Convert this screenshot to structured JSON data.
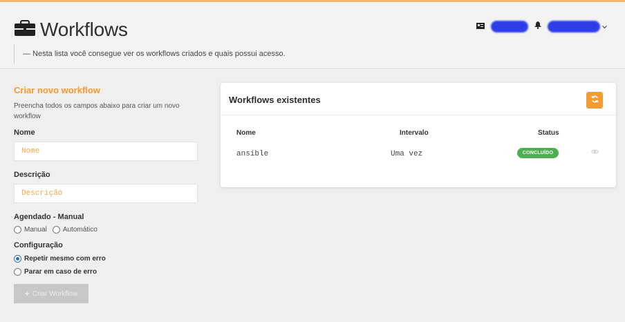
{
  "header": {
    "title": "Workflows",
    "subtitle": "— Nesta lista você consegue ver os workflows criados e quais possui acesso."
  },
  "form": {
    "title": "Criar novo workflow",
    "description": "Preencha todos os campos abaixo para criar um novo workflow",
    "name_label": "Nome",
    "name_placeholder": "Nome",
    "description_label": "Descrição",
    "description_placeholder": "Descrição",
    "schedule_label": "Agendado - Manual",
    "schedule_options": [
      "Manual",
      "Automático"
    ],
    "config_label": "Configuração",
    "config_options": [
      "Repetir mesmo com erro",
      "Parar em caso de erro"
    ],
    "config_selected": "Repetir mesmo com erro",
    "create_button_label": "Criar Workflow"
  },
  "table": {
    "title": "Workflows existentes",
    "columns": [
      "Nome",
      "Intervalo",
      "Status"
    ],
    "rows": [
      {
        "name": "ansible",
        "interval": "Uma vez",
        "status": "CONCLUÍDO"
      }
    ]
  },
  "icons": {
    "brand": "briefcase-icon",
    "notifications": "bell-icon",
    "refresh": "refresh-icon",
    "view": "eye-icon",
    "add": "plus-icon",
    "user_dropdown": "chevron-down-icon"
  },
  "colors": {
    "accent": "#f29b33",
    "success": "#4caf50",
    "radio_selected": "#2f6db5"
  }
}
